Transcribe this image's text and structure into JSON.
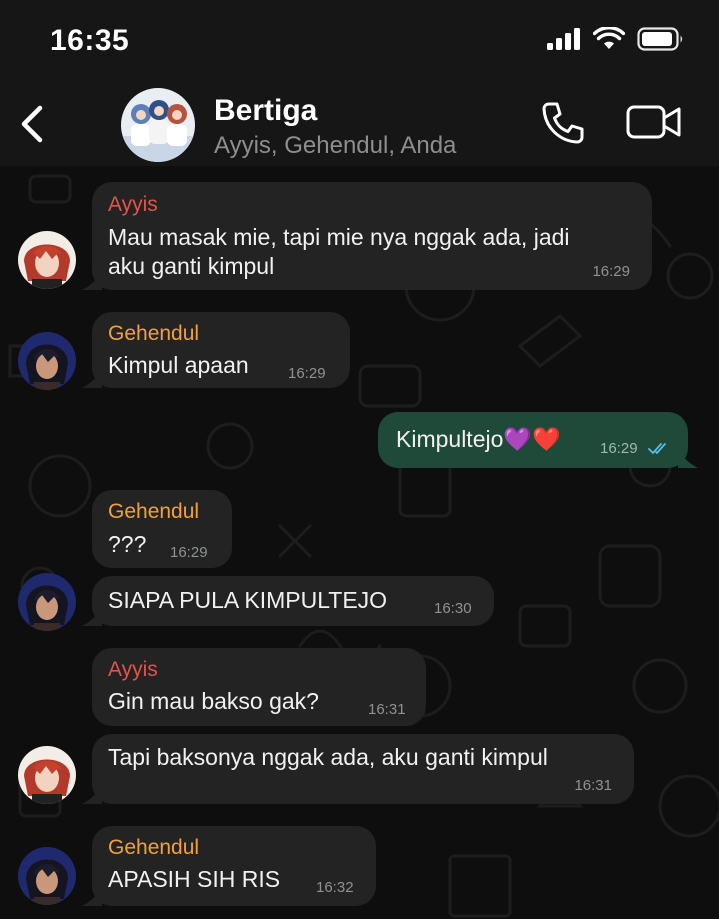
{
  "status_bar": {
    "time": "16:35"
  },
  "header": {
    "title": "Bertiga",
    "subtitle": "Ayyis, Gehendul, Anda"
  },
  "colors": {
    "ayyis": "#e2534d",
    "gehendul": "#f0a23a",
    "outgoing_bubble": "#1f4a39",
    "incoming_bubble": "#232323",
    "read_ticks": "#53bdeb"
  },
  "messages": [
    {
      "sender": "Ayyis",
      "lines": [
        "Mau masak mie, tapi mie nya nggak ada, jadi",
        "aku ganti kimpul"
      ],
      "time": "16:29"
    },
    {
      "sender": "Gehendul",
      "lines": [
        "Kimpul apaan"
      ],
      "time": "16:29"
    },
    {
      "sender": "",
      "lines": [
        "Kimpultejo💜❤️"
      ],
      "time": "16:29",
      "status": "read"
    },
    {
      "sender": "Gehendul",
      "lines": [
        "???"
      ],
      "time": "16:29"
    },
    {
      "sender": "",
      "lines": [
        "SIAPA PULA KIMPULTEJO"
      ],
      "time": "16:30"
    },
    {
      "sender": "Ayyis",
      "lines": [
        "Gin mau bakso gak?"
      ],
      "time": "16:31"
    },
    {
      "sender": "",
      "lines": [
        "Tapi baksonya nggak ada, aku ganti kimpul"
      ],
      "time": "16:31"
    },
    {
      "sender": "Gehendul",
      "lines": [
        "APASIH SIH RIS"
      ],
      "time": "16:32"
    }
  ]
}
